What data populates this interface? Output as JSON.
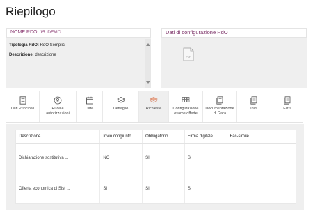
{
  "page": {
    "title": "Riepilogo"
  },
  "rdo_panel": {
    "label": "NOME RDO:",
    "value": "15. DEMO",
    "tipologia_label": "Tipologia RdO:",
    "tipologia_value": "RdO Semplici",
    "descrizione_label": "Descrizione:",
    "descrizione_value": "descrizione"
  },
  "config_panel": {
    "title": "Dati di configurazione RdO",
    "file_icon": "pdf-file-icon",
    "file_icon_text": "PDF"
  },
  "tabs": [
    {
      "label": "Dati Principali",
      "icon": "document-list-icon"
    },
    {
      "label": "Ruoli e autorizzazioni",
      "icon": "roles-icon"
    },
    {
      "label": "Date",
      "icon": "calendar-icon"
    },
    {
      "label": "Dettaglio",
      "icon": "layers-icon"
    },
    {
      "label": "Richieste",
      "icon": "layers-active-icon",
      "active": true
    },
    {
      "label": "Configurazione esame offerte",
      "icon": "grid-settings-icon"
    },
    {
      "label": "Documentazione di Gara",
      "icon": "documents-icon"
    },
    {
      "label": "Invii",
      "icon": "send-docs-icon"
    },
    {
      "label": "Filtri",
      "icon": "filter-docs-icon"
    }
  ],
  "table": {
    "headers": [
      "Descrizione",
      "Invio congiunto",
      "Obbligatorio",
      "Firma digitale",
      "Fac-simile"
    ],
    "rows": [
      [
        "Dichiarazione sostitutiva ...",
        "NO",
        "SI",
        "SI",
        ""
      ],
      [
        "Offerta economica di Sist ...",
        "SI",
        "SI",
        "SI",
        ""
      ]
    ]
  },
  "colors": {
    "accent": "#8a3a72",
    "panel_bg": "#efefef",
    "border": "#e3e3e3"
  }
}
